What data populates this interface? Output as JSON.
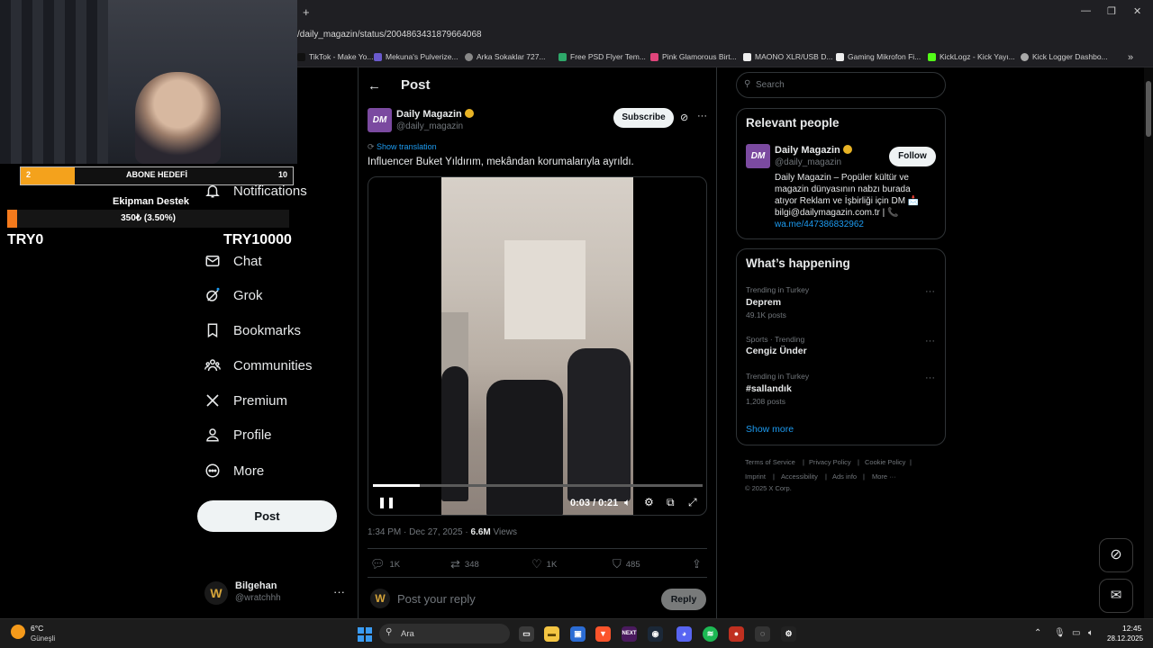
{
  "browser": {
    "new_tab": "+",
    "url": "/daily_magazin/status/2004863431879664068",
    "bookmarks": [
      {
        "label": "TikTok - Make Yo...",
        "color": "#111111"
      },
      {
        "label": "Mekuna's Pulverize...",
        "color": "#6a5acd"
      },
      {
        "label": "Arka Sokaklar 727...",
        "color": "#888888"
      },
      {
        "label": "Free PSD Flyer Tem...",
        "color": "#2ea86a"
      },
      {
        "label": "Pink Glamorous Birt...",
        "color": "#e0457b"
      },
      {
        "label": "MAONO XLR/USB D...",
        "color": "#eeeeee"
      },
      {
        "label": "Gaming Mikrofon Fi...",
        "color": "#eeeeee"
      },
      {
        "label": "KickLogz - Kick Yayı...",
        "color": "#53fc18"
      },
      {
        "label": "Kick Logger Dashbo...",
        "color": "#aaaaaa"
      }
    ],
    "bookmarks_overflow": "»"
  },
  "stream_overlay": {
    "sub_goal": {
      "current": "2",
      "label": "ABONE HEDEFİ",
      "target": "10",
      "fraction": 0.2
    },
    "donation": {
      "title": "Ekipman Destek",
      "progress_text": "350₺ (3.50%)",
      "fraction": 0.035,
      "min_label": "TRY0",
      "max_label": "TRY10000"
    }
  },
  "nav": {
    "items": [
      {
        "label": "Notifications",
        "icon": "bell-icon"
      },
      {
        "label": "Chat",
        "icon": "mail-icon"
      },
      {
        "label": "Grok",
        "icon": "grok-icon"
      },
      {
        "label": "Bookmarks",
        "icon": "bookmark-icon"
      },
      {
        "label": "Communities",
        "icon": "communities-icon"
      },
      {
        "label": "Premium",
        "icon": "x-logo-icon"
      },
      {
        "label": "Profile",
        "icon": "person-icon"
      },
      {
        "label": "More",
        "icon": "more-circle-icon"
      }
    ],
    "post_button": "Post",
    "profile": {
      "name": "Bilgehan",
      "handle": "@wratchhh",
      "more": "···"
    }
  },
  "post": {
    "heading": "Post",
    "author": {
      "avatar": "DM",
      "name": "Daily Magazin",
      "handle": "@daily_magazin"
    },
    "subscribe": "Subscribe",
    "more": "···",
    "show_translation": "Show translation",
    "text": "Influencer Buket Yıldırım, mekândan korumalarıyla ayrıldı.",
    "video": {
      "current": "0:03",
      "duration": "0:21",
      "time_text": "0:03 / 0:21",
      "progress_fraction": 0.143
    },
    "meta": {
      "time": "1:34 PM · Dec 27, 2025 · ",
      "views": "6.6M",
      "views_label": " Views"
    },
    "stats": {
      "replies": "1K",
      "reposts": "348",
      "likes": "1K",
      "bookmarks": "485"
    },
    "reply_placeholder": "Post your reply",
    "reply_button": "Reply"
  },
  "sidebar": {
    "search_placeholder": "Search",
    "relevant": {
      "title": "Relevant people",
      "avatar": "DM",
      "name": "Daily Magazin",
      "handle": "@daily_magazin",
      "follow": "Follow",
      "bio": "Daily Magazin – Popüler kültür ve magazin dünyasının nabzı burada atıyor Reklam ve İşbirliği için DM 📩 bilgi@dailymagazin.com.tr | 📞",
      "link": "wa.me/447386832962"
    },
    "happening": {
      "title": "What’s happening",
      "trends": [
        {
          "category": "Trending in Turkey",
          "name": "Deprem",
          "count": "49.1K posts"
        },
        {
          "category": "Sports · Trending",
          "name": "Cengiz Ünder",
          "count": ""
        },
        {
          "category": "Trending in Turkey",
          "name": "#sallandık",
          "count": "1,208 posts"
        }
      ],
      "show_more": "Show more"
    },
    "footer": {
      "links": [
        "Terms of Service",
        "Privacy Policy",
        "Cookie Policy",
        "Imprint",
        "Accessibility",
        "Ads info",
        "More ···"
      ],
      "copyright": "© 2025 X Corp."
    }
  },
  "taskbar": {
    "weather": {
      "temp": "6°C",
      "desc": "Güneşli"
    },
    "search_placeholder": "Ara",
    "clock": {
      "time": "12:45",
      "date": "28.12.2025"
    }
  }
}
